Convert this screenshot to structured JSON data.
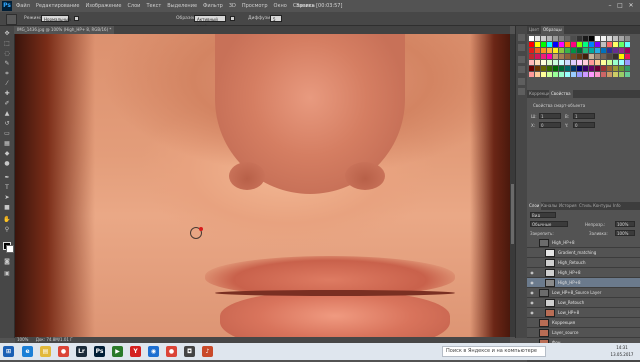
{
  "app": {
    "logo": "Ps"
  },
  "menu": {
    "items": [
      "Файл",
      "Редактирование",
      "Изображение",
      "Слои",
      "Текст",
      "Выделение",
      "Фильтр",
      "3D",
      "Просмотр",
      "Окно",
      "Справка"
    ],
    "document_title": "Запись [00:03:57]",
    "window_controls": [
      "–",
      "□",
      "✕"
    ]
  },
  "options_bar": {
    "mode_label": "Режим:",
    "mode_value": "Нормальный",
    "sample_label": "Образец:",
    "sample_value": "Активный слой",
    "diffusion_label": "Диффузия:",
    "diffusion_value": "5"
  },
  "document": {
    "tab_title": "IMG_1436.jpg @ 100% (High_HP+ 8, RGB/16) *",
    "status_zoom": "100%",
    "status_doc": "Док: 74.8M/1.01 Г"
  },
  "toolbar": {
    "tools": [
      "move-tool",
      "marquee-tool",
      "lasso-tool",
      "quick-select-tool",
      "crop-tool",
      "eyedropper-tool",
      "healing-tool",
      "brush-tool",
      "stamp-tool",
      "history-brush-tool",
      "eraser-tool",
      "gradient-tool",
      "blur-tool",
      "dodge-tool",
      "pen-tool",
      "type-tool",
      "path-select-tool",
      "shape-tool",
      "hand-tool",
      "zoom-tool"
    ],
    "foreground_color": "#000000",
    "background_color": "#ffffff"
  },
  "swatches_panel": {
    "tabs": [
      "Цвет",
      "Образцы"
    ],
    "active_tab": "Образцы",
    "colors": [
      "#ffffff",
      "#e6e6e6",
      "#cccccc",
      "#b3b3b3",
      "#999999",
      "#808080",
      "#666666",
      "#4d4d4d",
      "#333333",
      "#1a1a1a",
      "#000000",
      "#ffffff",
      "#f2f2f2",
      "#d9d9d9",
      "#bfbfbf",
      "#a6a6a6",
      "#8c8c8c",
      "#ff0000",
      "#ffff00",
      "#00ff00",
      "#00ffff",
      "#0000ff",
      "#ff00ff",
      "#ff8000",
      "#ff0080",
      "#80ff00",
      "#00ff80",
      "#0080ff",
      "#8000ff",
      "#c0c0c0",
      "#ff6666",
      "#ffff66",
      "#66ff66",
      "#66ffff",
      "#e21b1b",
      "#f15a24",
      "#f7931e",
      "#fbb03b",
      "#fcee21",
      "#8cc63f",
      "#39b54a",
      "#009245",
      "#006837",
      "#22b573",
      "#00a99d",
      "#29abe2",
      "#0071bc",
      "#2e3192",
      "#662d91",
      "#93278f",
      "#9e005d",
      "#c1272d",
      "#d4145a",
      "#ed1e79",
      "#f0a",
      "#c69c6d",
      "#a67c52",
      "#8c6239",
      "#754c24",
      "#603813",
      "#42210b",
      "#c7b299",
      "#998675",
      "#736357",
      "#534741",
      "#362f2d",
      "#fff200",
      "#ed145b",
      "#fbb",
      "#fdb",
      "#ffd",
      "#dfc",
      "#cfd",
      "#cff",
      "#cdf",
      "#dcf",
      "#fcf",
      "#fcd",
      "#f99",
      "#fc9",
      "#ff9",
      "#cf9",
      "#9fc",
      "#9ff",
      "#99f",
      "#660000",
      "#663300",
      "#666600",
      "#336600",
      "#006600",
      "#006633",
      "#006666",
      "#003366",
      "#000066",
      "#330066",
      "#660066",
      "#660033",
      "#993333",
      "#996633",
      "#999933",
      "#669933",
      "#339966",
      "#ff9999",
      "#ffcc99",
      "#ffff99",
      "#ccff99",
      "#99ff99",
      "#99ffcc",
      "#99ffff",
      "#99ccff",
      "#9999ff",
      "#cc99ff",
      "#ff99ff",
      "#ff99cc",
      "#cc6666",
      "#cc9966",
      "#cccc66",
      "#99cc66",
      "#66cc99"
    ]
  },
  "properties_panel": {
    "tabs": [
      "Коррекция",
      "Свойства"
    ],
    "active_tab": "Свойства",
    "title": "Свойства смарт-объекта",
    "w_label": "Ш:",
    "w_value": "1",
    "h_label": "В:",
    "h_value": "1",
    "x_label": "X:",
    "x_value": "0",
    "y_label": "Y:",
    "y_value": "0"
  },
  "layers_panel": {
    "tabs": [
      "Слои",
      "Каналы",
      "История",
      "Стиль",
      "Контуры",
      "Info"
    ],
    "active_tab": "Слои",
    "filter_kind": "Вид",
    "blend_mode": "Обычные",
    "opacity_label": "Непрозр.:",
    "opacity_value": "100%",
    "lock_label": "Закрепить:",
    "fill_label": "Заливка:",
    "fill_value": "100%",
    "layers": [
      {
        "name": "High_HP+8",
        "visible": false,
        "selected": false,
        "thumb": "#6b6b6b",
        "indent": 0
      },
      {
        "name": "Gradient_matching",
        "visible": false,
        "selected": false,
        "thumb": "#e6e6e6",
        "indent": 1
      },
      {
        "name": "High_Retouch",
        "visible": false,
        "selected": false,
        "thumb": "#cfcfcf",
        "indent": 1
      },
      {
        "name": "High_HP+8",
        "visible": true,
        "selected": false,
        "thumb": "#cfcfcf",
        "indent": 1
      },
      {
        "name": "High_HP+8",
        "visible": true,
        "selected": true,
        "thumb": "#8a8a8a",
        "indent": 1
      },
      {
        "name": "Low_HP+8_Source Layer",
        "visible": true,
        "selected": false,
        "thumb": "#6b6b6b",
        "indent": 0
      },
      {
        "name": "Low_Retouch",
        "visible": true,
        "selected": false,
        "thumb": "#cfcfcf",
        "indent": 1
      },
      {
        "name": "Low_HP+8",
        "visible": true,
        "selected": false,
        "thumb": "#b86d55",
        "indent": 1
      },
      {
        "name": "Коррекция",
        "visible": false,
        "selected": false,
        "thumb": "#b86d55",
        "indent": 0
      },
      {
        "name": "Layer_source",
        "visible": false,
        "selected": false,
        "thumb": "#b86d55",
        "indent": 0
      },
      {
        "name": "Фон",
        "visible": false,
        "selected": false,
        "thumb": "#b86d55",
        "indent": 0
      }
    ],
    "footer_icons": [
      "link-icon",
      "fx-icon",
      "mask-icon",
      "adjustment-icon",
      "group-icon",
      "new-layer-icon",
      "trash-icon"
    ]
  },
  "taskbar": {
    "search_placeholder": "Поиск в Яндексе и на компьютере",
    "time": "14:31",
    "date": "13.05.2017",
    "apps": [
      {
        "name": "ie-icon",
        "glyph": "e",
        "color": "#1b7fd6"
      },
      {
        "name": "explorer-icon",
        "glyph": "▤",
        "color": "#e2b93b"
      },
      {
        "name": "chrome-icon",
        "glyph": "●",
        "color": "#db4437"
      },
      {
        "name": "lightroom-icon",
        "glyph": "Lr",
        "color": "#1b2b3a"
      },
      {
        "name": "photoshop-icon",
        "glyph": "Ps",
        "color": "#001e36"
      },
      {
        "name": "player-icon",
        "glyph": "▶",
        "color": "#2a7a2a"
      },
      {
        "name": "yandex-icon",
        "glyph": "Y",
        "color": "#d42020"
      },
      {
        "name": "browser-icon",
        "glyph": "◉",
        "color": "#1d6fd1"
      },
      {
        "name": "chrome2-icon",
        "glyph": "●",
        "color": "#db4437"
      },
      {
        "name": "camera-icon",
        "glyph": "◘",
        "color": "#444444"
      },
      {
        "name": "media-icon",
        "glyph": "♪",
        "color": "#c94a2a"
      }
    ]
  }
}
